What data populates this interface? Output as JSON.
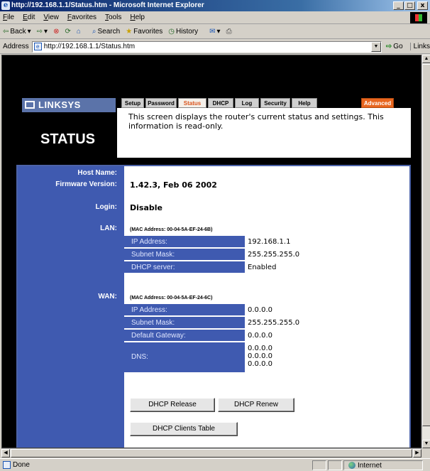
{
  "window": {
    "title": "http://192.168.1.1/Status.htm - Microsoft Internet Explorer",
    "controls": [
      "_",
      "□",
      "x"
    ]
  },
  "menu": [
    "File",
    "Edit",
    "View",
    "Favorites",
    "Tools",
    "Help"
  ],
  "toolbar": {
    "back": "Back",
    "search": "Search",
    "favorites": "Favorites",
    "history": "History"
  },
  "address": {
    "label": "Address",
    "url": "http://192.168.1.1/Status.htm",
    "go": "Go",
    "links": "Links"
  },
  "statusbar": {
    "text": "Done",
    "zone": "Internet"
  },
  "page": {
    "logo": "LINKSYS",
    "title": "STATUS",
    "tabs": [
      "Setup",
      "Password",
      "Status",
      "DHCP",
      "Log",
      "Security",
      "Help",
      "Advanced"
    ],
    "description": "This screen displays the router's current status and settings. This information is read-only.",
    "labels": {
      "host_name": "Host Name:",
      "firmware": "Firmware Version:",
      "login": "Login:",
      "lan": "LAN:",
      "wan": "WAN:"
    },
    "firmware_version": "1.42.3, Feb 06 2002",
    "login_value": "Disable",
    "lan": {
      "mac": "(MAC Address: 00-04-5A-EF-24-6B)",
      "rows": [
        {
          "label": "IP Address:",
          "value": "192.168.1.1"
        },
        {
          "label": "Subnet Mask:",
          "value": "255.255.255.0"
        },
        {
          "label": "DHCP server:",
          "value": "Enabled"
        }
      ]
    },
    "wan": {
      "mac": "(MAC Address: 00-04-5A-EF-24-6C)",
      "rows": [
        {
          "label": "IP Address:",
          "value": "0.0.0.0"
        },
        {
          "label": "Subnet Mask:",
          "value": "255.255.255.0"
        },
        {
          "label": "Default Gateway:",
          "value": "0.0.0.0"
        }
      ],
      "dns_label": "DNS:",
      "dns": [
        "0.0.0.0",
        "0.0.0.0",
        "0.0.0.0"
      ]
    },
    "buttons": {
      "release": "DHCP Release",
      "renew": "DHCP Renew",
      "clients": "DHCP Clients Table"
    }
  },
  "colors": {
    "linksys_blue": "#3f5ab0",
    "advanced_tab": "#e8661f",
    "active_tab_text": "#d9541d"
  }
}
